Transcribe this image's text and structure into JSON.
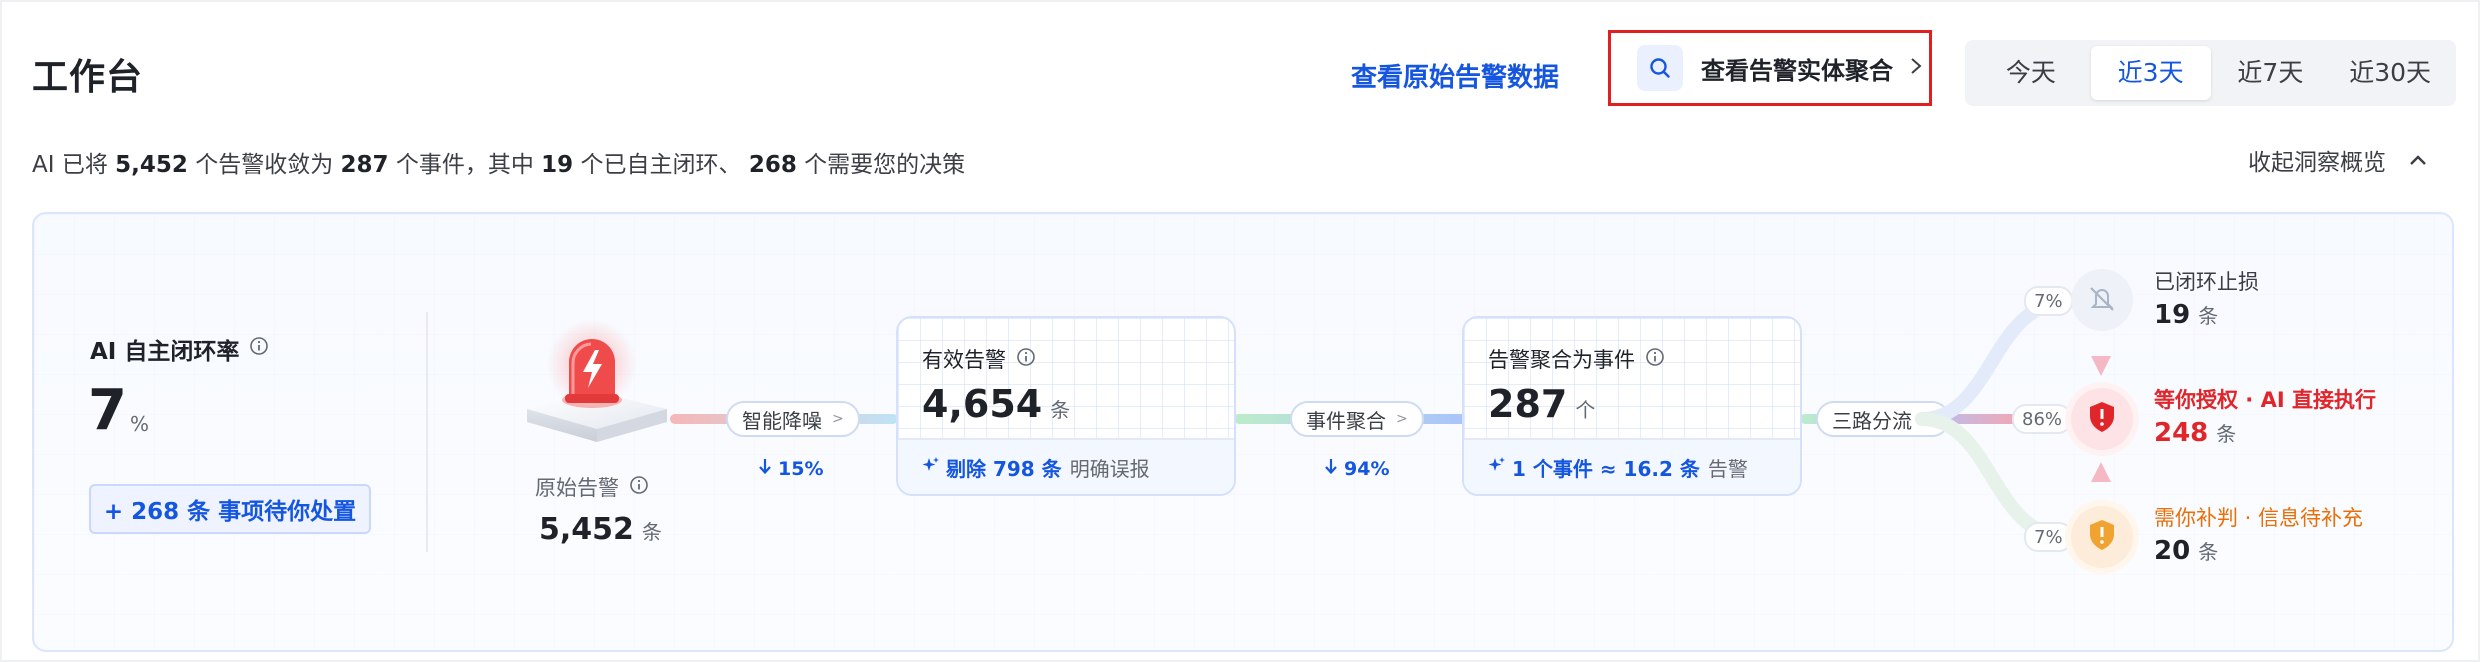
{
  "header": {
    "title": "工作台",
    "raw_link": "查看原始告警数据",
    "entity_button": "查看告警实体聚合",
    "ranges": [
      "今天",
      "近3天",
      "近7天",
      "近30天"
    ],
    "active_range": "近3天"
  },
  "summary": {
    "prefix": "AI 已将",
    "alerts": "5,452",
    "mid1": "个告警收敛为",
    "events": "287",
    "mid2": "个事件，其中",
    "closed": "19",
    "mid3": "个已自主闭环、",
    "decisions": "268",
    "suffix": "个需要您的决策",
    "collapse_label": "收起洞察概览"
  },
  "overview": {
    "rate_label": "AI 自主闭环率",
    "rate_value": "7",
    "rate_unit": "%",
    "pending_button": "+ 268 条 事项待你处置"
  },
  "flow": {
    "raw": {
      "label": "原始告警",
      "value": "5,452",
      "unit": "条"
    },
    "step1": {
      "chip": "智能降噪",
      "pct": "15%"
    },
    "valid": {
      "label": "有效告警",
      "value": "4,654",
      "unit": "条",
      "foot_highlight": "剔除 798 条",
      "foot_rest": "明确误报"
    },
    "step2": {
      "chip": "事件聚合",
      "pct": "94%"
    },
    "events": {
      "label": "告警聚合为事件",
      "value": "287",
      "unit": "个",
      "foot_highlight": "1 个事件 ≈ 16.2 条",
      "foot_rest": "告警"
    },
    "step3": {
      "chip": "三路分流"
    },
    "outcomes": [
      {
        "pct": "7%",
        "title": "已闭环止损",
        "value": "19",
        "unit": "条",
        "color": "#1f2329",
        "icon": "muted-bell-icon"
      },
      {
        "pct": "86%",
        "title": "等你授权 · AI 直接执行",
        "value": "248",
        "unit": "条",
        "color": "#e0262b",
        "icon": "shield-alert-icon"
      },
      {
        "pct": "7%",
        "title": "需你补判 · 信息待补充",
        "value": "20",
        "unit": "条",
        "color": "#e8700a",
        "icon": "shield-warning-icon"
      }
    ]
  },
  "colors": {
    "accent": "#1556e0",
    "danger": "#e0262b",
    "warning": "#e8700a"
  }
}
